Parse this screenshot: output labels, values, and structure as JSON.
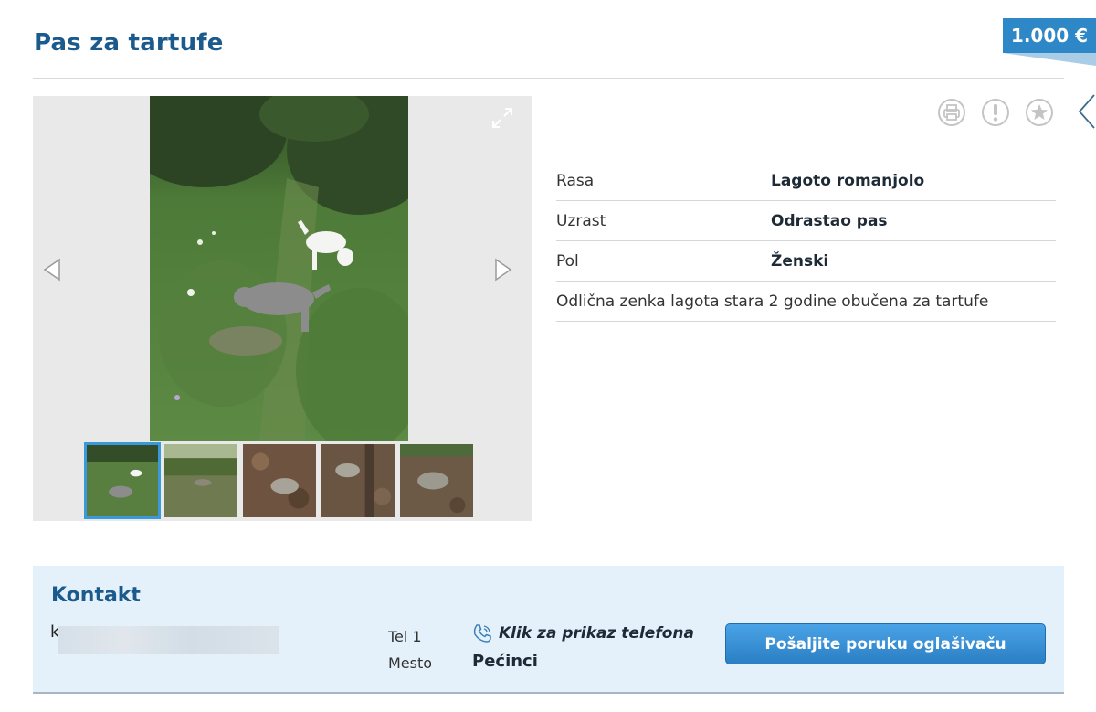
{
  "listing": {
    "title": "Pas za tartufe",
    "price": "1.000 €"
  },
  "gallery": {
    "thumbnails": [
      "photo-1",
      "photo-2",
      "photo-3",
      "photo-4",
      "photo-5"
    ],
    "active_index": 0
  },
  "actions": {
    "icons": [
      "print-icon",
      "report-icon",
      "favorite-star-icon"
    ]
  },
  "specs": {
    "rows": [
      {
        "label": "Rasa",
        "value": "Lagoto romanjolo"
      },
      {
        "label": "Uzrast",
        "value": "Odrastao pas"
      },
      {
        "label": "Pol",
        "value": "Ženski"
      }
    ],
    "description": "Odlična zenka lagota stara 2 godine obučena za tartufe"
  },
  "contact": {
    "title": "Kontakt",
    "name_initial": "k",
    "tel_label": "Tel 1",
    "city_label": "Mesto",
    "phone_link": "Klik za prikaz telefona",
    "city_value": "Pećinci",
    "send_button": "Pošaljite poruku oglašivaču"
  },
  "colors": {
    "brand_blue": "#1b5a8c",
    "price_blue": "#2e87c6",
    "contact_bg": "#e4f0fa",
    "button_blue": "#2b7fc4"
  }
}
